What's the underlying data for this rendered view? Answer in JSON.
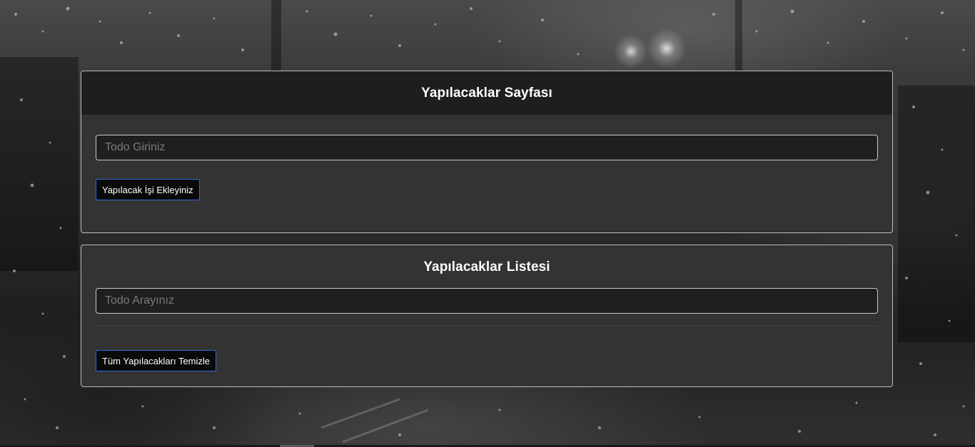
{
  "todo_form": {
    "title": "Yapılacaklar Sayfası",
    "input_placeholder": "Todo Giriniz",
    "input_value": "",
    "add_button_label": "Yapılacak İşi Ekleyiniz"
  },
  "todo_list": {
    "title": "Yapılacaklar Listesi",
    "search_placeholder": "Todo Arayınız",
    "search_value": "",
    "items": [],
    "clear_button_label": "Tüm Yapılacakları Temizle"
  },
  "colors": {
    "card_background": "#333333",
    "card_header_background": "#1e1e1e",
    "button_border": "#2f6bd9",
    "input_background": "#1f1f1f"
  }
}
